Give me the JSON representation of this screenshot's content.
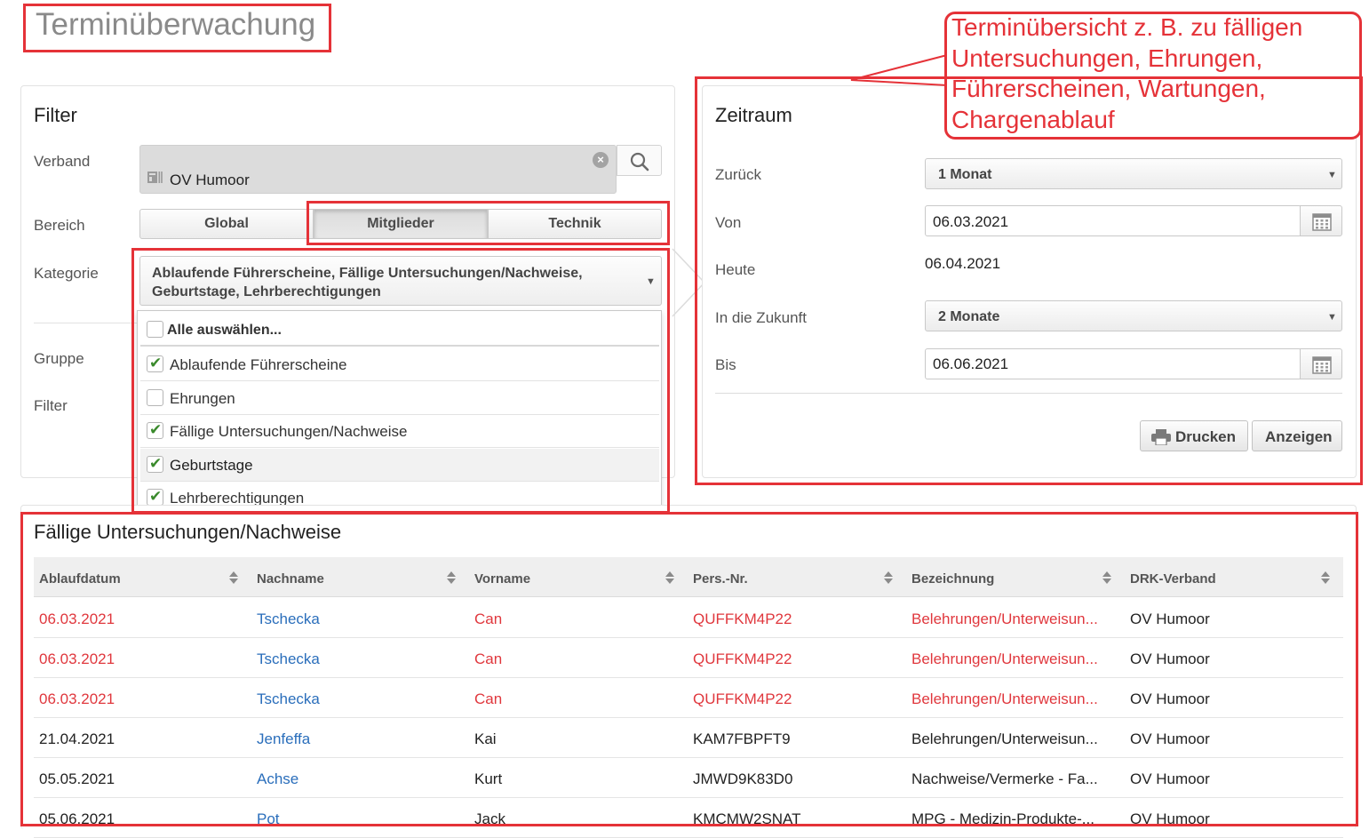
{
  "page": {
    "title": "Terminüberwachung"
  },
  "callout": {
    "lines": [
      "Terminübersicht z. B. zu fälligen",
      "Untersuchungen, Ehrungen,",
      "Führerscheinen, Wartungen,",
      "Chargenablauf"
    ]
  },
  "filter": {
    "title": "Filter",
    "verband_label": "Verband",
    "verband_value": "OV Humoor",
    "bereich_label": "Bereich",
    "bereich_options": [
      "Global",
      "Mitglieder",
      "Technik"
    ],
    "bereich_selected": "Mitglieder",
    "kategorie_label": "Kategorie",
    "kategorie_value": "Ablaufende Führerscheine, Fällige Untersuchungen/Nachweise, Geburtstage, Lehrberechtigungen",
    "gruppe_label": "Gruppe",
    "filter_label": "Filter",
    "dropdown": {
      "select_all": "Alle auswählen...",
      "items": [
        {
          "label": "Ablaufende Führerscheine",
          "checked": true
        },
        {
          "label": "Ehrungen",
          "checked": false
        },
        {
          "label": "Fällige Untersuchungen/Nachweise",
          "checked": true
        },
        {
          "label": "Geburtstage",
          "checked": true
        },
        {
          "label": "Lehrberechtigungen",
          "checked": true
        }
      ]
    }
  },
  "zeitraum": {
    "title": "Zeitraum",
    "zurueck_label": "Zurück",
    "zurueck_value": "1 Monat",
    "von_label": "Von",
    "von_value": "06.03.2021",
    "heute_label": "Heute",
    "heute_value": "06.04.2021",
    "zukunft_label": "In die Zukunft",
    "zukunft_value": "2 Monate",
    "bis_label": "Bis",
    "bis_value": "06.06.2021",
    "print_label": "Drucken",
    "show_label": "Anzeigen"
  },
  "results": {
    "title": "Fällige Untersuchungen/Nachweise",
    "columns": [
      "Ablaufdatum",
      "Nachname",
      "Vorname",
      "Pers.-Nr.",
      "Bezeichnung",
      "DRK-Verband"
    ],
    "rows": [
      {
        "date": "06.03.2021",
        "nachname": "Tschecka",
        "vorname": "Can",
        "persnr": "QUFFKM4P22",
        "bezeichnung": "Belehrungen/Unterweisun...",
        "verband": "OV Humoor",
        "overdue": true
      },
      {
        "date": "06.03.2021",
        "nachname": "Tschecka",
        "vorname": "Can",
        "persnr": "QUFFKM4P22",
        "bezeichnung": "Belehrungen/Unterweisun...",
        "verband": "OV Humoor",
        "overdue": true
      },
      {
        "date": "06.03.2021",
        "nachname": "Tschecka",
        "vorname": "Can",
        "persnr": "QUFFKM4P22",
        "bezeichnung": "Belehrungen/Unterweisun...",
        "verband": "OV Humoor",
        "overdue": true
      },
      {
        "date": "21.04.2021",
        "nachname": "Jenfeffa",
        "vorname": "Kai",
        "persnr": "KAM7FBPFT9",
        "bezeichnung": "Belehrungen/Unterweisun...",
        "verband": "OV Humoor",
        "overdue": false
      },
      {
        "date": "05.05.2021",
        "nachname": "Achse",
        "vorname": "Kurt",
        "persnr": "JMWD9K83D0",
        "bezeichnung": "Nachweise/Vermerke - Fa...",
        "verband": "OV Humoor",
        "overdue": false
      },
      {
        "date": "05.06.2021",
        "nachname": "Pot",
        "vorname": "Jack",
        "persnr": "KMCMW2SNAT",
        "bezeichnung": "MPG - Medizin-Produkte-...",
        "verband": "OV Humoor",
        "overdue": false
      }
    ]
  },
  "colors": {
    "annotation_red": "#e53238",
    "overdue_red": "#e0373d",
    "link_blue": "#2a6ebb",
    "check_green": "#3a8a2c"
  }
}
